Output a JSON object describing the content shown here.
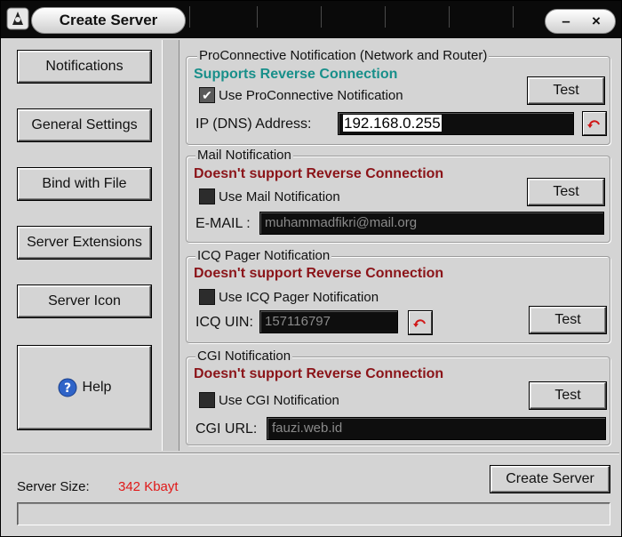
{
  "window": {
    "title": "Create Server",
    "minimize_glyph": "–",
    "close_glyph": "×"
  },
  "nav": {
    "notifications": "Notifications",
    "general_settings": "General Settings",
    "bind_with_file": "Bind with File",
    "server_extensions": "Server Extensions",
    "server_icon": "Server Icon",
    "help": "Help"
  },
  "proconnective": {
    "title": "ProConnective Notification (Network and Router)",
    "status": "Supports Reverse Connection",
    "checkbox_label": "Use ProConnective Notification",
    "checked": true,
    "test_label": "Test",
    "field_label": "IP (DNS) Address:",
    "field_value": "192.168.0.255"
  },
  "mail": {
    "title": "Mail Notification",
    "status": "Doesn't support Reverse Connection",
    "checkbox_label": "Use Mail Notification",
    "checked": false,
    "test_label": "Test",
    "field_label": "E-MAIL :",
    "field_value": "muhammadfikri@mail.org"
  },
  "icq": {
    "title": "ICQ Pager Notification",
    "status": "Doesn't support Reverse Connection",
    "checkbox_label": "Use ICQ Pager Notification",
    "checked": false,
    "test_label": "Test",
    "field_label": "ICQ UIN:",
    "field_value": "157116797"
  },
  "cgi": {
    "title": "CGI Notification",
    "status": "Doesn't support Reverse Connection",
    "checkbox_label": "Use CGI Notification",
    "checked": false,
    "test_label": "Test",
    "field_label": "CGI URL:",
    "field_value": "fauzi.web.id"
  },
  "footer": {
    "server_size_label": "Server Size:",
    "server_size_value": "342 Kbayt",
    "create_server_label": "Create Server",
    "progress": 0
  },
  "colors": {
    "supports": "#188f8a",
    "not_supported": "#8b1419",
    "size_value": "#e01818"
  },
  "icons": {
    "app": "app-logo-icon",
    "help": "help-question-icon",
    "refresh": "refresh-arrow-icon",
    "check": "checkmark-icon"
  }
}
